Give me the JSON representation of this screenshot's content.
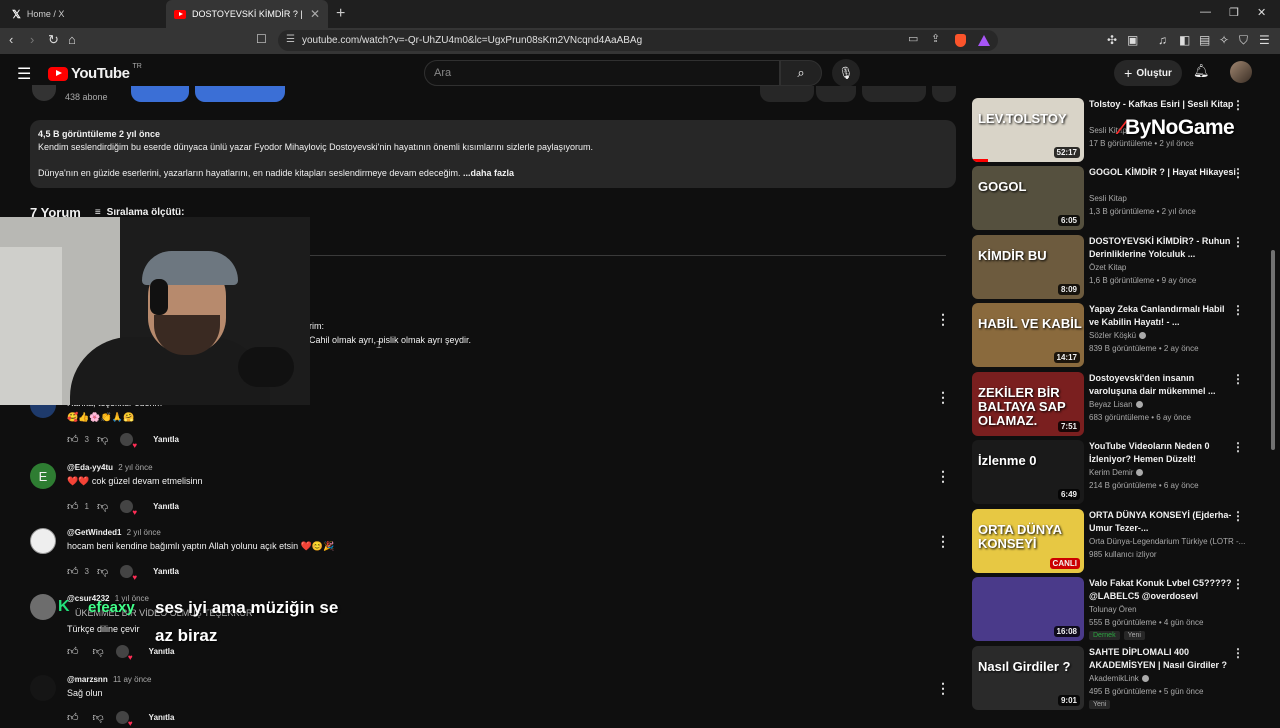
{
  "browser": {
    "tabs": [
      {
        "title": "Home / X"
      },
      {
        "title": "DOSTOYEVSKİ KİMDİR ? | Hayat Hik"
      }
    ],
    "url": "youtube.com/watch?v=-Qr-UhZU4m0&lc=UgxPrun08sKm2VNcqnd4AaABAg"
  },
  "header": {
    "logo_text": "YouTube",
    "logo_region": "TR",
    "search_placeholder": "Ara",
    "create_label": "Oluştur"
  },
  "channel": {
    "subscribers": "438 abone"
  },
  "description": {
    "meta": "4,5 B görüntüleme  2 yıl önce",
    "line1": "Kendim seslendirdiğim bu eserde dünyaca ünlü yazar Fyodor Mihayloviç Dostoyevski'nin hayatının önemli kısımlarını sizlerle paylaşıyorum.",
    "line2": "Dünya'nın en güzide eserlerini, yazarların hayatlarını, en nadide kitapları seslendirmeye devam edeceğim.",
    "more": "...daha fazla"
  },
  "comments_header": {
    "count": "7 Yorum",
    "sort_label": "Sıralama ölçütü:"
  },
  "pinned_fragment": {
    "line1": "rim:",
    "line2": "Cahil olmak ayrı, pislik olmak ayrı şeydir."
  },
  "comments": [
    {
      "user": "",
      "time": "",
      "text": "Harika, teşekkür ederim",
      "emoji": "🥰👍🌸👏🙏🤗",
      "likes": "3",
      "reply": "Yanıtla"
    },
    {
      "user": "@Eda-yy4tu",
      "time": "2 yıl önce",
      "text": "❤️❤️ cok güzel devam etmelisinn",
      "likes": "1",
      "reply": "Yanıtla",
      "avatar_letter": "E"
    },
    {
      "user": "@GetWinded1",
      "time": "2 yıl önce",
      "text": "hocam beni kendine bağımlı yaptın Allah yolunu açık etsin ❤️😊🎉",
      "likes": "3",
      "reply": "Yanıtla"
    },
    {
      "user": "@csur4232",
      "time": "1 yıl önce",
      "text": "Türkçe diline çevir",
      "likes": "",
      "reply": "Yanıtla",
      "overlap": "ÜKEMMEL BİR VİDEO OLMUŞ TEŞEKKÜR"
    },
    {
      "user": "@marzsnn",
      "time": "11 ay önce",
      "text": "Sağ olun",
      "likes": "",
      "reply": "Yanıtla"
    }
  ],
  "chat_overlay": {
    "badge": "K",
    "user": "efeaxy",
    "line1": "ses iyi ama müziğin se",
    "line2": "az biraz"
  },
  "watermark": "ByNoGame",
  "sidebar": [
    {
      "title": "Tolstoy - Kafkas Esiri | Sesli Kitap",
      "channel": "Sesli Kitap",
      "views": "17 B görüntüleme • 2 yıl önce",
      "duration": "52:17",
      "thumb_text": "LEV.TOLSTOY",
      "color": "#d9d4c8"
    },
    {
      "title": "GOGOL KİMDİR ? | Hayat Hikayesi",
      "channel": "Sesli Kitap",
      "views": "1,3 B görüntüleme • 2 yıl önce",
      "duration": "6:05",
      "thumb_text": "GOGOL",
      "color": "#55503e"
    },
    {
      "title": "DOSTOYEVSKİ KİMDİR? - Ruhun Derinliklerine Yolculuk ...",
      "channel": "Özet Kitap",
      "views": "1,6 B görüntüleme • 9 ay önce",
      "duration": "8:09",
      "thumb_text": "KİMDİR BU",
      "color": "#6d5b3e"
    },
    {
      "title": "Yapay Zeka Canlandırmalı Habil ve Kabilin Hayatı! - ...",
      "channel": "Sözler Köşkü",
      "views": "839 B görüntüleme • 2 ay önce",
      "duration": "14:17",
      "thumb_text": "HABİL VE KABİL",
      "color": "#8a6a3d"
    },
    {
      "title": "Dostoyevski'den insanın varoluşuna dair mükemmel ...",
      "channel": "Beyaz Lisan",
      "views": "683 görüntüleme • 6 ay önce",
      "duration": "7:51",
      "thumb_text": "ZEKİLER BİR BALTAYA SAP OLAMAZ.",
      "color": "#7a1f1f"
    },
    {
      "title": "YouTube Videoların Neden 0 İzleniyor? Hemen Düzelt!",
      "channel": "Kerim Demir",
      "views": "214 B görüntüleme • 6 ay önce",
      "duration": "6:49",
      "thumb_text": "İzlenme 0",
      "color": "#1a1a1a"
    },
    {
      "title": "ORTA DÜNYA KONSEYİ (Ejderha-Umur Tezer-...",
      "channel": "Orta Dünya-Legendarium Türkiye (LOTR -...",
      "views": "985 kullanıcı izliyor",
      "duration": "CANLI",
      "thumb_text": "ORTA DÜNYA KONSEYİ",
      "color": "#e7c843"
    },
    {
      "title": "Valo Fakat Konuk Lvbel C5????? @LABELC5 @overdosevl",
      "channel": "Tolunay Ören",
      "views": "555 B görüntüleme • 4 gün önce",
      "duration": "16:08",
      "thumb_text": "",
      "color": "#4a3a8a",
      "chips": [
        "Dernek",
        "Yeni"
      ]
    },
    {
      "title": "SAHTE DİPLOMALI 400 AKADEMİSYEN | Nasıl Girdiler ?",
      "channel": "AkademikLink",
      "views": "495 B görüntüleme • 5 gün önce",
      "duration": "9:01",
      "thumb_text": "Nasıl Girdiler ?",
      "color": "#2a2a2a",
      "chips": [
        "Yeni"
      ]
    }
  ],
  "colors": {
    "accent": "#ff0000",
    "background": "#0f0f0f",
    "surface": "#272727",
    "link": "#3ea6ff"
  }
}
